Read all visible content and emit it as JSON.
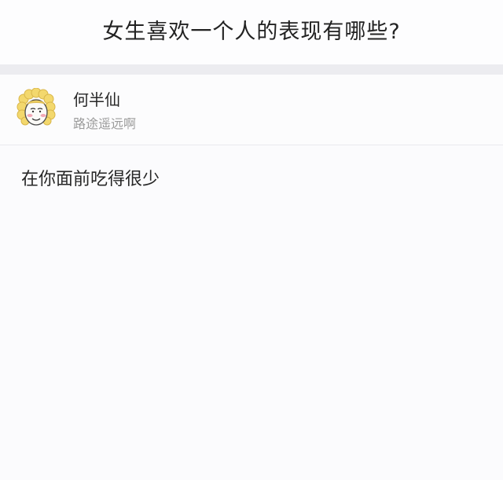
{
  "question": {
    "title": "女生喜欢一个人的表现有哪些?"
  },
  "author": {
    "name": "何半仙",
    "bio": "路途遥远啊",
    "avatar_icon": "curly-haired-cartoon-face-icon"
  },
  "answer": {
    "text": "在你面前吃得很少"
  },
  "colors": {
    "divider_band": "#ececf0",
    "bio_text": "#9b9b9b",
    "avatar_hair": "#f2d46a"
  }
}
